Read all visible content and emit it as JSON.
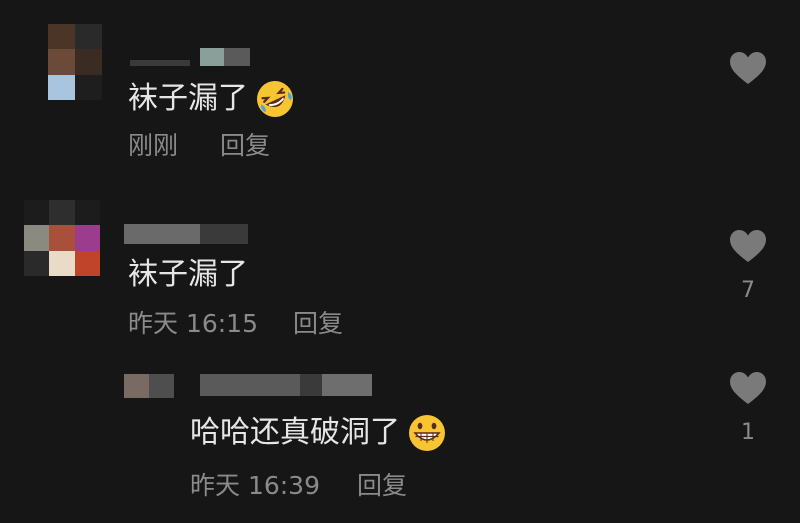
{
  "colors": {
    "background": "#161616",
    "text": "#e6e6e6",
    "muted": "#8a8a8a",
    "heart": "#7a7a7a"
  },
  "comments": [
    {
      "text": "袜子漏了",
      "emoji": "rolling-on-floor-laughing-emoji",
      "time": "刚刚",
      "reply_label": "回复",
      "likes": ""
    },
    {
      "text": "袜子漏了",
      "emoji": "",
      "time": "昨天 16:15",
      "reply_label": "回复",
      "likes": "7"
    },
    {
      "text": "哈哈还真破洞了",
      "emoji": "grinning-face-emoji",
      "time": "昨天 16:39",
      "reply_label": "回复",
      "likes": "1"
    }
  ]
}
